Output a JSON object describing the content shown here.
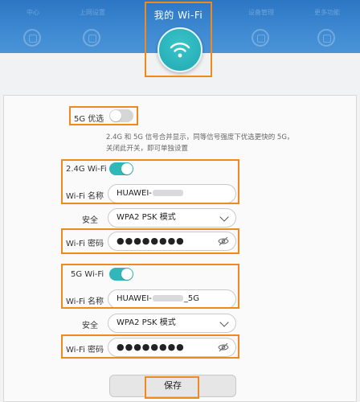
{
  "header": {
    "title": "我的 Wi-Fi",
    "nav_ghost_labels": [
      "中心",
      "上网设置",
      "",
      "设备管理",
      "更多功能"
    ]
  },
  "prefer_5g": {
    "label": "5G 优选",
    "enabled": false,
    "description": "2.4G 和 5G 信号合并显示，同等信号强度下优选更快的 5G，关闭此开关，即可单独设置"
  },
  "band_24g": {
    "toggle_label": "2.4G Wi-Fi",
    "enabled": true,
    "name_label": "Wi-Fi 名称",
    "name_prefix": "HUAWEI-",
    "name_suffix": "",
    "security_label": "安全",
    "security_value": "WPA2 PSK 模式",
    "password_label": "Wi-Fi 密码",
    "password_mask": "●●●●●●●●"
  },
  "band_5g": {
    "toggle_label": "5G Wi-Fi",
    "enabled": true,
    "name_label": "Wi-Fi 名称",
    "name_prefix": "HUAWEI-",
    "name_suffix": "_5G",
    "security_label": "安全",
    "security_value": "WPA2 PSK 模式",
    "password_label": "Wi-Fi 密码",
    "password_mask": "●●●●●●●●"
  },
  "actions": {
    "save_label": "保存"
  },
  "colors": {
    "banner": "#2c76c4",
    "accent": "#2fb7b9",
    "highlight": "#f08a1c"
  }
}
